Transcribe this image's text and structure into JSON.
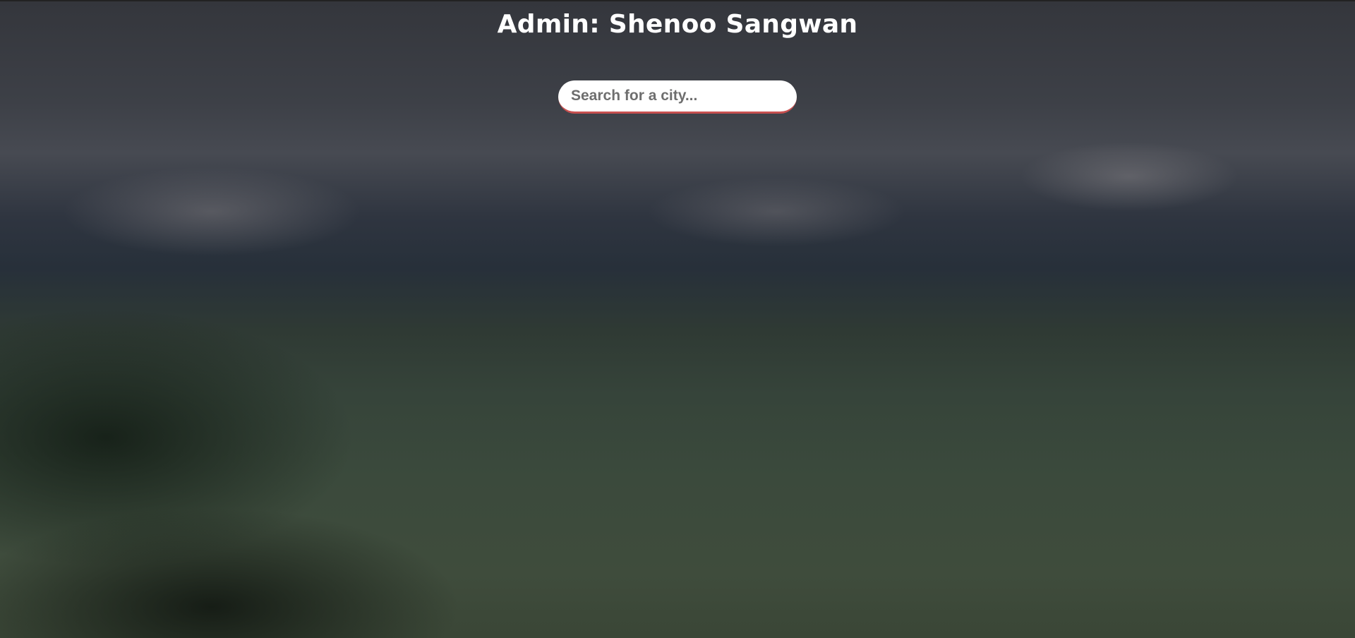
{
  "header": {
    "title": "Admin: Shenoo Sangwan"
  },
  "search": {
    "placeholder": "Search for a city...",
    "value": ""
  },
  "colors": {
    "accent": "#c85050"
  }
}
